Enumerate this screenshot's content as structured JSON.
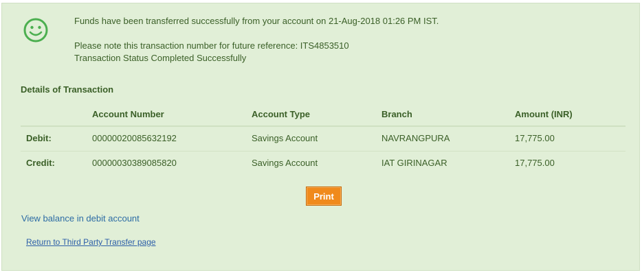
{
  "status": {
    "icon": "smiley-icon",
    "message": "Funds have been transferred successfully from your account on 21-Aug-2018 01:26 PM IST.",
    "reference_note": "Please note this transaction number for future reference: ITS4853510",
    "transaction_status": "Transaction Status Completed Successfully"
  },
  "details": {
    "title": "Details of Transaction",
    "headers": [
      "",
      "Account Number",
      "Account Type",
      "Branch",
      "Amount (INR)"
    ],
    "rows": [
      [
        "Debit:",
        "00000020085632192",
        "Savings Account",
        "NAVRANGPURA",
        "17,775.00"
      ],
      [
        "Credit:",
        "00000030389085820",
        "Savings Account",
        "IAT GIRINAGAR",
        "17,775.00"
      ]
    ]
  },
  "actions": {
    "print_label": "Print",
    "view_balance_label": "View balance in debit account",
    "return_label": "Return to Third Party Transfer page"
  },
  "colors": {
    "panel_bg": "#e1efd7",
    "accent_green": "#4caf50",
    "print_button": "#f08a1c",
    "link": "#2c6ba4"
  }
}
